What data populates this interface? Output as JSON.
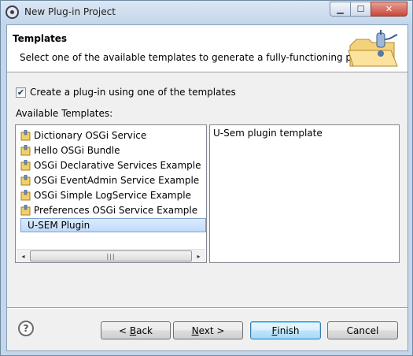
{
  "window": {
    "title": "New Plug-in Project",
    "controls": [
      "minimize",
      "maximize",
      "close"
    ]
  },
  "header": {
    "title": "Templates",
    "description": "Select one of the available templates to generate a fully-functioning plug-in."
  },
  "options": {
    "use_template_label": "Create a plug-in using one of the templates",
    "use_template_checked": true,
    "available_templates_label": "Available Templates:"
  },
  "templates": {
    "items": [
      {
        "label": "Dictionary OSGi Service",
        "selected": false
      },
      {
        "label": "Hello OSGi Bundle",
        "selected": false
      },
      {
        "label": "OSGi Declarative Services Example",
        "selected": false
      },
      {
        "label": "OSGi EventAdmin Service Example",
        "selected": false
      },
      {
        "label": "OSGi Simple LogService Example",
        "selected": false
      },
      {
        "label": "Preferences OSGi Service Example",
        "selected": false
      },
      {
        "label": "U-SEM Plugin",
        "selected": true
      }
    ],
    "scrollbar": {
      "left_arrow": "◂",
      "thumb": "|||",
      "right_arrow": "▸"
    }
  },
  "description_panel": {
    "text": "U-Sem plugin template"
  },
  "buttons": {
    "help": "?",
    "back_prefix": "< ",
    "back_mnemonic": "B",
    "back_rest": "ack",
    "next_mnemonic": "N",
    "next_rest": "ext >",
    "finish_mnemonic": "F",
    "finish_rest": "inish",
    "cancel": "Cancel"
  },
  "colors": {
    "selection": "#c1dbfc",
    "default_button_border": "#3c7fb1",
    "header_background": "#ffffff"
  }
}
